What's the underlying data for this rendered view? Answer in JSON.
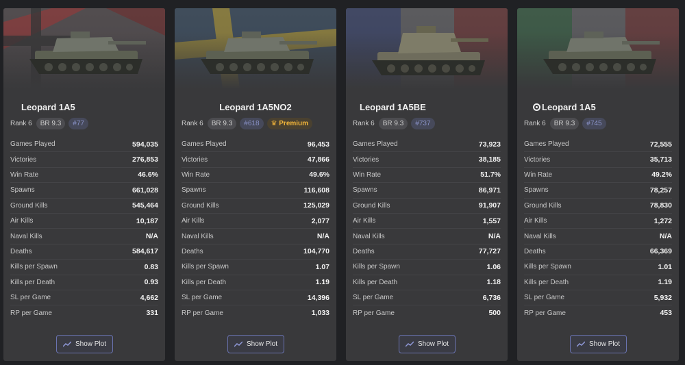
{
  "show_plot_label": "Show Plot",
  "stat_labels": [
    "Games Played",
    "Victories",
    "Win Rate",
    "Spawns",
    "Ground Kills",
    "Air Kills",
    "Naval Kills",
    "Deaths",
    "Kills per Spawn",
    "Kills per Death",
    "SL per Game",
    "RP per Game"
  ],
  "cards": [
    {
      "name": "Leopard 1A5",
      "rank": "Rank 6",
      "br": "BR 9.3",
      "id": "#77",
      "premium": "",
      "icon": "",
      "flag": "germany",
      "stats": [
        "594,035",
        "276,853",
        "46.6%",
        "661,028",
        "545,464",
        "10,187",
        "N/A",
        "584,617",
        "0.83",
        "0.93",
        "4,662",
        "331"
      ]
    },
    {
      "name": "Leopard 1A5NO2",
      "rank": "Rank 6",
      "br": "BR 9.3",
      "id": "#618",
      "premium": "♛ Premium",
      "icon": "",
      "flag": "sweden",
      "stats": [
        "96,453",
        "47,866",
        "49.6%",
        "116,608",
        "125,029",
        "2,077",
        "N/A",
        "104,770",
        "1.07",
        "1.19",
        "14,396",
        "1,033"
      ]
    },
    {
      "name": "Leopard 1A5BE",
      "rank": "Rank 6",
      "br": "BR 9.3",
      "id": "#737",
      "premium": "",
      "icon": "",
      "flag": "france",
      "stats": [
        "73,923",
        "38,185",
        "51.7%",
        "86,971",
        "91,907",
        "1,557",
        "N/A",
        "77,727",
        "1.06",
        "1.18",
        "6,736",
        "500"
      ]
    },
    {
      "name": "Leopard 1A5",
      "rank": "Rank 6",
      "br": "BR 9.3",
      "id": "#745",
      "premium": "",
      "icon": "target-icon",
      "flag": "italy",
      "stats": [
        "72,555",
        "35,713",
        "49.2%",
        "78,257",
        "78,830",
        "1,272",
        "N/A",
        "66,369",
        "1.01",
        "1.19",
        "5,932",
        "453"
      ]
    }
  ]
}
